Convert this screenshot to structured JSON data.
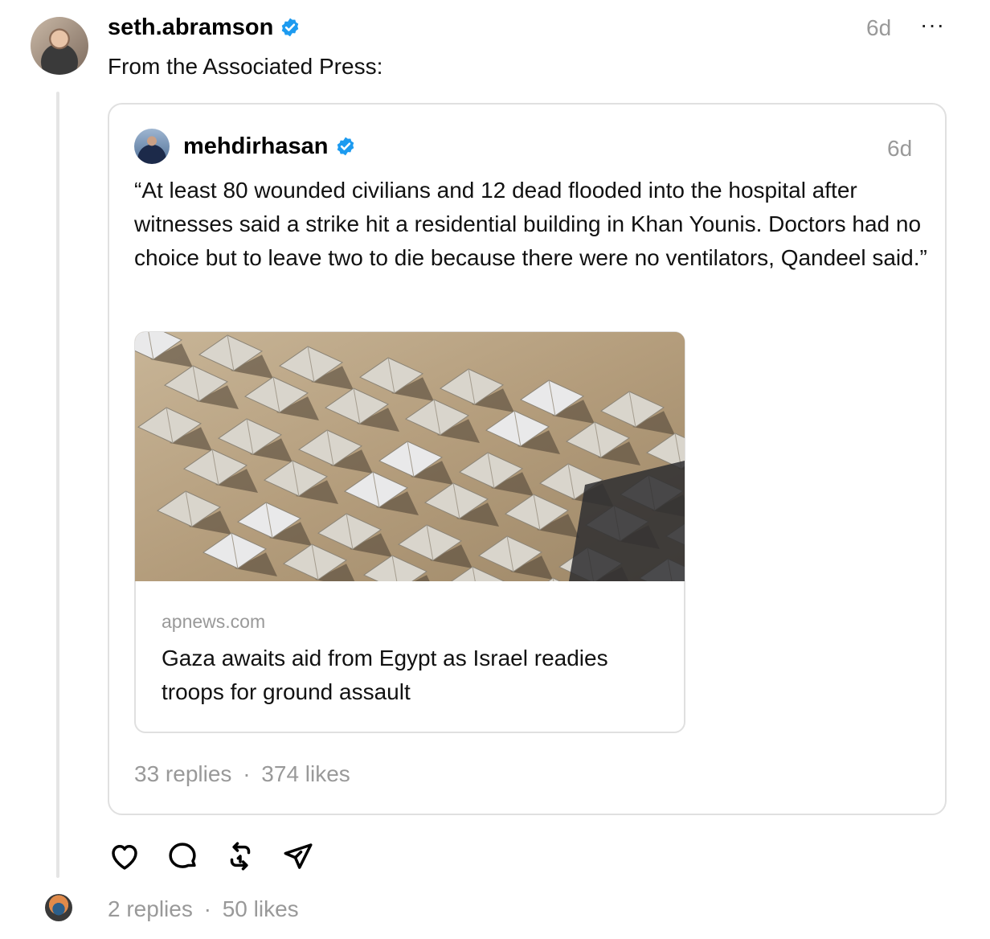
{
  "post": {
    "username": "seth.abramson",
    "time": "6d",
    "more_label": "···",
    "text": "From the Associated Press:",
    "stats": {
      "replies": "2 replies",
      "separator": "·",
      "likes": "50 likes"
    }
  },
  "quoted_post": {
    "username": "mehdirhasan",
    "time": "6d",
    "text": "“At least 80 wounded civilians and 12 dead flooded into the hospital after witnesses said a strike hit a residential building in Khan Younis. Doctors had no choice but to leave two to die because there were no ventilators, Qandeel said.”",
    "link_preview": {
      "domain": "apnews.com",
      "title": "Gaza awaits aid from Egypt as Israel readies troops for ground assault"
    },
    "stats": {
      "replies": "33 replies",
      "separator": "·",
      "likes": "374 likes"
    }
  },
  "actions": {
    "icons": [
      "heart-icon",
      "comment-icon",
      "repost-icon",
      "share-icon"
    ]
  },
  "colors": {
    "verified": "#1d9bf0",
    "muted_text": "#999999",
    "border": "#e0e0e0"
  }
}
